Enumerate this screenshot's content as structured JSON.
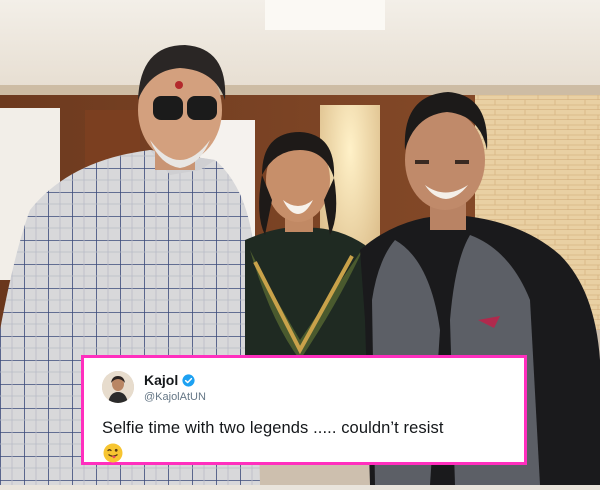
{
  "tweet": {
    "author_name": "Kajol",
    "author_handle": "@KajolAtUN",
    "text": "Selfie time with two legends ..... couldn’t resist",
    "verified": true,
    "emoji": "winking-face-with-tongue"
  },
  "colors": {
    "tweet_border": "#ff2fbe",
    "verified_badge": "#1da1f2",
    "handle": "#657786"
  }
}
